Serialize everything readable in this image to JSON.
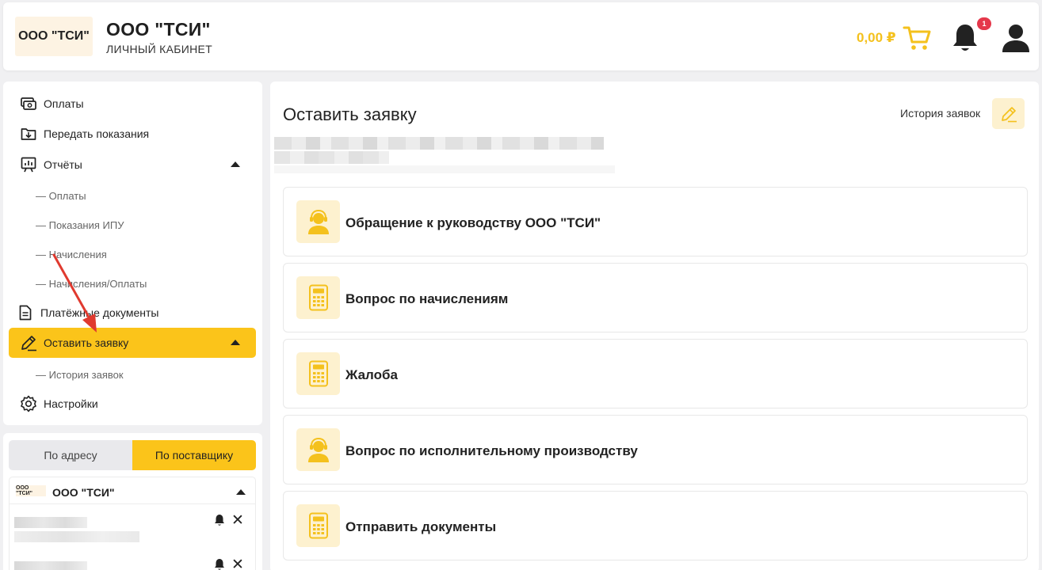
{
  "header": {
    "logo_text": "ООО \"ТСИ\"",
    "title": "ООО \"ТСИ\"",
    "subtitle": "ЛИЧНЫЙ КАБИНЕТ",
    "balance": "0,00 ₽",
    "notification_count": "1",
    "icons": {
      "cart": "cart-icon",
      "bell": "bell-icon",
      "user": "user-icon"
    },
    "accent_color": "#f4c11d"
  },
  "sidebar": {
    "menu": [
      {
        "label": "Оплаты",
        "icon": "payment-icon"
      },
      {
        "label": "Передать показания",
        "icon": "download-folder-icon"
      },
      {
        "label": "Отчёты",
        "icon": "report-icon",
        "expanded": true
      },
      {
        "label": "Платёжные документы",
        "icon": "document-icon"
      },
      {
        "label": "Оставить заявку",
        "icon": "pencil-icon",
        "expanded": true,
        "active": true
      },
      {
        "label": "Настройки",
        "icon": "gear-icon"
      }
    ],
    "reports_sub": [
      "— Оплаты",
      "— Показания ИПУ",
      "— Начисления",
      "— Начисления/Оплаты"
    ],
    "request_sub": [
      "— История заявок"
    ],
    "active_color": "#fbc41a"
  },
  "tabs": {
    "by_address": "По адресу",
    "by_provider": "По поставщику",
    "selected": "По поставщику"
  },
  "provider": {
    "logo_text": "ООО \"ТСИ\"",
    "name": "ООО \"ТСИ\""
  },
  "main": {
    "title": "Оставить заявку",
    "history_link": "История заявок",
    "requests": [
      {
        "label": "Обращение к руководству ООО \"ТСИ\"",
        "icon": "support-agent-icon"
      },
      {
        "label": "Вопрос по начислениям",
        "icon": "calculator-icon"
      },
      {
        "label": "Жалоба",
        "icon": "calculator-icon"
      },
      {
        "label": "Вопрос по исполнительному производству",
        "icon": "support-agent-icon"
      },
      {
        "label": "Отправить документы",
        "icon": "calculator-icon"
      }
    ]
  }
}
